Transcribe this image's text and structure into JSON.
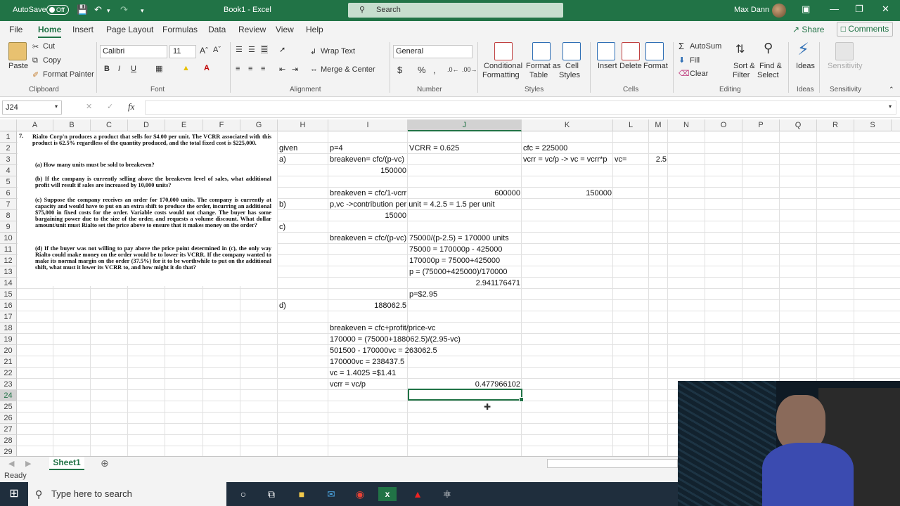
{
  "titlebar": {
    "autosave_label": "AutoSave",
    "autosave_state": "Off",
    "doc_title": "Book1 - Excel",
    "search_placeholder": "Search",
    "user_name": "Max Dann"
  },
  "menu": {
    "tabs": [
      "File",
      "Home",
      "Insert",
      "Page Layout",
      "Formulas",
      "Data",
      "Review",
      "View",
      "Help"
    ],
    "active": "Home",
    "share": "Share",
    "comments": "Comments"
  },
  "ribbon": {
    "clipboard": {
      "paste": "Paste",
      "cut": "Cut",
      "copy": "Copy",
      "format_painter": "Format Painter",
      "group": "Clipboard"
    },
    "font": {
      "name": "Calibri",
      "size": "11",
      "group": "Font"
    },
    "alignment": {
      "wrap": "Wrap Text",
      "merge": "Merge & Center",
      "group": "Alignment"
    },
    "number": {
      "format": "General",
      "group": "Number"
    },
    "styles": {
      "conditional": "Conditional",
      "formatting": "Formatting",
      "format_as": "Format as",
      "table": "Table",
      "cell": "Cell",
      "cell_styles": "Styles",
      "group": "Styles"
    },
    "cells": {
      "insert": "Insert",
      "delete": "Delete",
      "format": "Format",
      "group": "Cells"
    },
    "editing": {
      "autosum": "AutoSum",
      "fill": "Fill",
      "clear": "Clear",
      "sort": "Sort &",
      "filter": "Filter",
      "find": "Find &",
      "select": "Select",
      "group": "Editing"
    },
    "ideas": {
      "label": "Ideas",
      "group": "Ideas"
    },
    "sensitivity": {
      "label": "Sensitivity",
      "group": "Sensitivity"
    }
  },
  "formula_bar": {
    "name_box": "J24",
    "fx": "fx",
    "content": ""
  },
  "columns": [
    "A",
    "B",
    "C",
    "D",
    "E",
    "F",
    "G",
    "H",
    "I",
    "J",
    "K",
    "L",
    "M",
    "N",
    "O",
    "P",
    "Q",
    "R",
    "S"
  ],
  "rows": [
    "1",
    "2",
    "3",
    "4",
    "5",
    "6",
    "7",
    "8",
    "9",
    "10",
    "11",
    "12",
    "13",
    "14",
    "15",
    "16",
    "17",
    "18",
    "19",
    "20",
    "21",
    "22",
    "23",
    "24",
    "25",
    "26",
    "27",
    "28",
    "29"
  ],
  "problem": {
    "number": "7.",
    "intro": "Rialto Corp'n produces a product that sells for $4.00 per unit. The VCRR associated with this product is 62.5% regardless of the quantity produced, and the total fixed cost is $225,000.",
    "a": "(a) How many units must be sold to breakeven?",
    "b": "(b) If the company is currently selling above the breakeven level of sales, what additional profit will result if sales are increased by 10,000 units?",
    "c": "(c) Suppose the company receives an order for 170,000 units. The company is currently at capacity and would have to put on an extra shift to produce the order, incurring an additional $75,000 in fixed costs for the order. Variable costs would not change. The buyer has some bargaining power due to the size of the order, and requests a volume discount. What dollar amount/unit must Rialto set the price above to ensure that it makes money on the order?",
    "d": "(d) If the buyer was not willing to pay above the price point determined in (c), the only way Rialto could make money on the order would be to lower its VCRR. If the company wanted to make its normal margin on the order (37.5%) for it to be worthwhile to put on the additional shift, what must it lower its VCRR to, and how might it do that?"
  },
  "cells": {
    "H2": "given",
    "I2": "p=4",
    "J2": "VCRR = 0.625",
    "K2": "cfc = 225000",
    "H3": "a)",
    "I3": "breakeven= cfc/(p-vc)",
    "K3": "vcrr = vc/p -> vc = vcrr*p",
    "L3": "vc=",
    "M3": "2.5",
    "I4": "150000",
    "I6": "breakeven = cfc/1-vcrr",
    "J6": "600000",
    "K6": "150000",
    "H7": "b)",
    "I7": "p,vc ->contribution per unit = 4.2.5 = 1.5 per unit",
    "I8": "15000",
    "H9": "c)",
    "I10": "breakeven = cfc/(p-vc)",
    "J10": "75000/(p-2.5) = 170000 units",
    "J11": "75000 = 170000p - 425000",
    "J12": "170000p = 75000+425000",
    "J13": "p = (75000+425000)/170000",
    "J14": "2.941176471",
    "J15": "p=$2.95",
    "H16": "d)",
    "I16": "188062.5",
    "I18": "breakeven = cfc+profit/price-vc",
    "I19": "170000 = (75000+188062.5)/(2.95-vc)",
    "I20": "501500 - 170000vc = 263062.5",
    "I21": "170000vc = 238437.5",
    "I22": "vc = 1.4025 =$1.41",
    "I23": "vcrr = vc/p",
    "J23": "0.477966102"
  },
  "sheet": {
    "tab": "Sheet1"
  },
  "status": {
    "text": "Ready"
  },
  "taskbar": {
    "search_placeholder": "Type here to search"
  },
  "colors": {
    "excel_green": "#217346",
    "taskbar": "#1f2e3d"
  }
}
